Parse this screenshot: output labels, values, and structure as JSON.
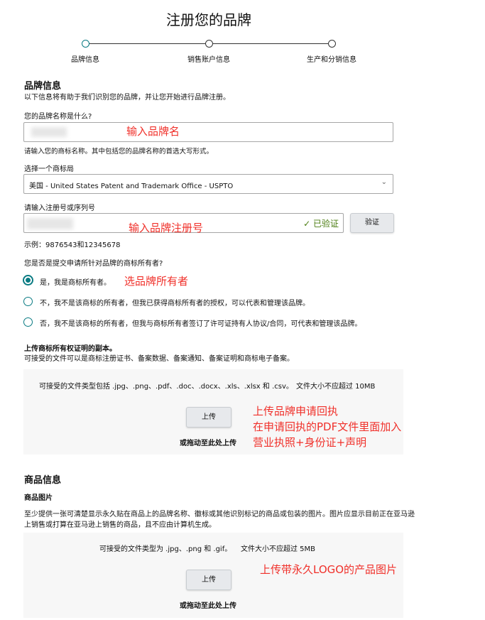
{
  "title": "注册您的品牌",
  "steps": [
    "品牌信息",
    "销售账户信息",
    "生产和分销信息"
  ],
  "brand": {
    "heading": "品牌信息",
    "intro": "以下信息将有助于我们识别您的品牌，并让您开始进行品牌注册。",
    "name_label": "您的品牌名称是什么?",
    "name_hint": "请输入您的商标名称。其中包括您的品牌名称的首选大写形式。",
    "office_label": "选择一个商标局",
    "office_value": "美国 - United States Patent and Trademark Office - USPTO",
    "reg_label": "请输入注册号或序列号",
    "verified": "已验证",
    "verify_button": "验证",
    "reg_example": "示例：9876543和12345678",
    "owner_question": "您是否是提交申请所针对品牌的商标所有者?",
    "options": [
      "是，我是商标所有者。",
      "不，我不是该商标的所有者，但我已获得商标所有者的授权，可以代表和管理该品牌。",
      "否，我不是该商标的所有者，但我与商标所有者签订了许可证持有人协议/合同，可代表和管理该品牌。"
    ],
    "upload_heading": "上传商标所有权证明的副本。",
    "upload_desc": "可接受的文件可以是商标注册证书、备案数据、备案通知、备案证明和商标电子备案。",
    "upload_types": "可接受的文件类型包括 .jpg、.png、.pdf、.doc、.docx、.xls、.xlsx 和 .csv。",
    "upload_size": "文件大小不应超过 10MB",
    "upload_button": "上传",
    "drag": "或拖动至此处上传"
  },
  "product": {
    "heading": "商品信息",
    "sub": "商品图片",
    "desc": "至少提供一张可清楚显示永久贴在商品上的品牌名称、徽标或其他识别标记的商品或包装的图片。图片应显示目前正在亚马逊上销售或打算在亚马逊上销售的商品，且不应由计算机生成。",
    "types": "可接受的文件类型为 .jpg、.png 和 .gif。",
    "size": "文件大小不应超过 5MB",
    "upload_button": "上传",
    "drag": "或拖动至此处上传"
  },
  "annotations": {
    "name": "输入品牌名",
    "reg": "输入品牌注册号",
    "owner": "选品牌所有者",
    "upload1": "上传品牌申请回执",
    "upload2": "在申请回执的PDF文件里面加入",
    "upload3": "营业执照+身份证+声明",
    "product": "上传带永久LOGO的产品图片"
  }
}
